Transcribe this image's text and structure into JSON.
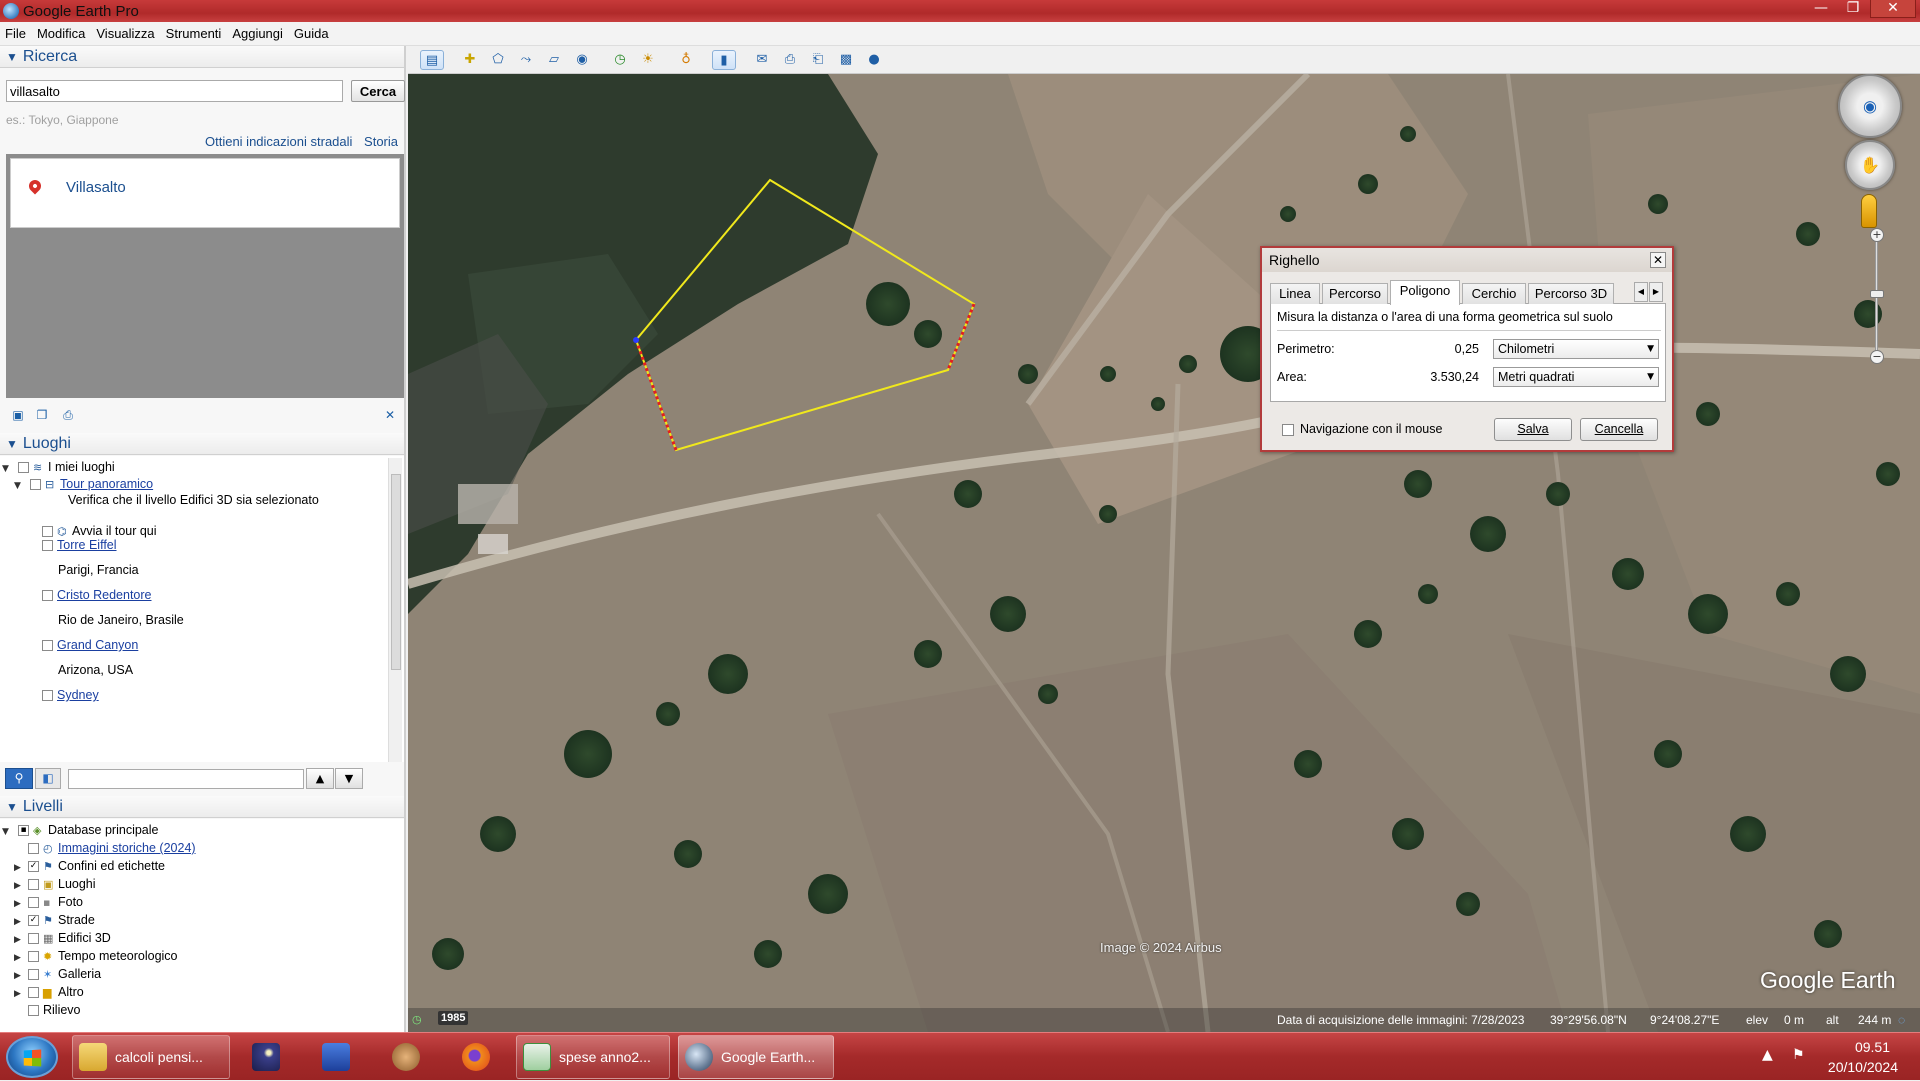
{
  "window": {
    "title": "Google Earth Pro",
    "controls": [
      "—",
      "❐",
      "✕"
    ]
  },
  "menu": [
    "File",
    "Modifica",
    "Visualizza",
    "Strumenti",
    "Aggiungi",
    "Guida"
  ],
  "search": {
    "header": "Ricerca",
    "value": "villasalto",
    "button": "Cerca",
    "hint": "es.: Tokyo, Giappone",
    "links": [
      "Ottieni indicazioni stradali",
      "Storia"
    ],
    "result": "Villasalto"
  },
  "places": {
    "header": "Luoghi",
    "items": [
      {
        "label": "I miei luoghi",
        "link": false
      },
      {
        "label": "Tour panoramico",
        "link": true,
        "note": "Verifica che il livello Edifici 3D sia selezionato"
      },
      {
        "label": "Avvia il tour qui",
        "link": false
      },
      {
        "label": "Torre Eiffel",
        "link": true,
        "note": "Parigi, Francia"
      },
      {
        "label": "Cristo Redentore",
        "link": true,
        "note": "Rio de Janeiro, Brasile"
      },
      {
        "label": "Grand Canyon",
        "link": true,
        "note": "Arizona, USA"
      },
      {
        "label": "Sydney",
        "link": true
      }
    ]
  },
  "layers": {
    "header": "Livelli",
    "items": [
      {
        "label": "Database principale",
        "checked": "partial"
      },
      {
        "label": "Immagini storiche (2024)",
        "checked": false,
        "link": true
      },
      {
        "label": "Confini ed etichette",
        "checked": true
      },
      {
        "label": "Luoghi",
        "checked": false
      },
      {
        "label": "Foto",
        "checked": false
      },
      {
        "label": "Strade",
        "checked": true
      },
      {
        "label": "Edifici 3D",
        "checked": false
      },
      {
        "label": "Tempo meteorologico",
        "checked": false
      },
      {
        "label": "Galleria",
        "checked": false
      },
      {
        "label": "Altro",
        "checked": false
      },
      {
        "label": "Rilievo",
        "checked": false
      }
    ]
  },
  "ruler": {
    "title": "Righello",
    "tabs": [
      "Linea",
      "Percorso",
      "Poligono",
      "Cerchio",
      "Percorso 3D"
    ],
    "active_tab": "Poligono",
    "description": "Misura la distanza o l'area di una forma geometrica sul suolo",
    "perimeter_label": "Perimetro:",
    "perimeter_value": "0,25",
    "perimeter_unit": "Chilometri",
    "area_label": "Area:",
    "area_value": "3.530,24",
    "area_unit": "Metri quadrati",
    "mouse_nav": "Navigazione con il mouse",
    "save": "Salva",
    "cancel": "Cancella"
  },
  "map": {
    "credit": "Image © 2024 Airbus",
    "watermark": "Google Earth",
    "year": "1985",
    "status": {
      "date": "Data di acquisizione delle immagini: 7/28/2023",
      "lat": "39°29'56.08\"N",
      "lon": "9°24'08.27\"E",
      "elev_label": "elev",
      "elev": "0 m",
      "alt_label": "alt",
      "alt": "244 m"
    },
    "compass_n": "N"
  },
  "taskbar": {
    "items": [
      {
        "label": "calcoli pensi...",
        "icon": "folder-icon",
        "color": "#e8c45a"
      },
      {
        "label": "",
        "icon": "night-sky-icon",
        "color": "#2a2f6e"
      },
      {
        "label": "",
        "icon": "app-z-icon",
        "color": "#2a59b8"
      },
      {
        "label": "",
        "icon": "creature-icon",
        "color": "#c58a4a"
      },
      {
        "label": "",
        "icon": "firefox-icon",
        "color": "#f08a1c"
      },
      {
        "label": "spese anno2...",
        "icon": "spreadsheet-icon",
        "color": "#3d8f3d"
      },
      {
        "label": "Google Earth...",
        "icon": "google-earth-icon",
        "color": "#6a7f99"
      }
    ],
    "time": "09.51",
    "date": "20/10/2024"
  }
}
